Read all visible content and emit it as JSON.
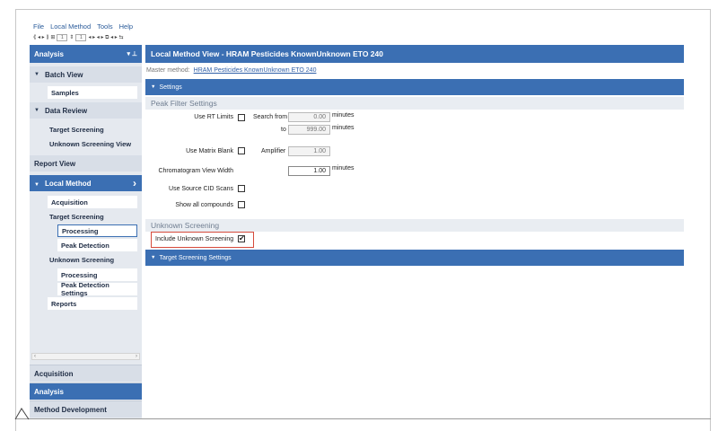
{
  "menu": {
    "file": "File",
    "local_method": "Local Method",
    "tools": "Tools",
    "help": "Help"
  },
  "toolbar": {
    "field_1": "1",
    "field_2": "1",
    "glyphs": "⟪ ◂ ▸ ⟫ ⊞",
    "glyphs2": "◂ ▸ ◂ ▸ ⧉ ◂ ▸ ⇆"
  },
  "nav": {
    "title": "Analysis",
    "pin_icon": "▾ ⊥",
    "batch_view": "Batch View",
    "samples": "Samples",
    "data_review": "Data Review",
    "target_screening": "Target Screening",
    "unknown_screening_view": "Unknown Screening View",
    "report_view": "Report View",
    "local_method": "Local Method",
    "local_method_arrow": "›",
    "acquisition": "Acquisition",
    "lm_target_screening": "Target Screening",
    "processing": "Processing",
    "peak_detection": "Peak Detection",
    "lm_unknown_screening": "Unknown Screening",
    "us_processing": "Processing",
    "peak_detection_settings": "Peak Detection Settings",
    "reports": "Reports",
    "scroll_left": "‹",
    "scroll_right": "›"
  },
  "bottom_tabs": {
    "acquisition": "Acquisition",
    "analysis": "Analysis",
    "method_development": "Method Development"
  },
  "main": {
    "title": "Local Method View - HRAM Pesticides KnownUnknown ETO 240",
    "master_label": "Master method:",
    "master_link": "HRAM Pesticides KnownUnknown ETO 240",
    "settings_bar": "Settings",
    "peak_filter_settings": "Peak Filter Settings",
    "use_rt_limits": "Use RT Limits",
    "search_from": "Search from",
    "search_from_value": "0.00",
    "to": "to",
    "to_value": "999.00",
    "minutes": "minutes",
    "use_matrix_blank": "Use Matrix Blank",
    "amplifier": "Amplifier",
    "amplifier_value": "1.00",
    "chromatogram_view_width": "Chromatogram View Width",
    "chromatogram_value": "1.00",
    "use_source_cid_scans": "Use Source CID Scans",
    "show_all_compounds": "Show all compounds",
    "unknown_screening": "Unknown Screening",
    "include_unknown_screening": "Include Unknown Screening",
    "target_screening_settings": "Target Screening Settings"
  },
  "state": {
    "include_unknown_screening_checked": true,
    "use_rt_limits_checked": false,
    "use_matrix_blank_checked": false
  },
  "colors": {
    "accent": "#3b6fb3",
    "highlight_border": "#d64b3c",
    "nav_bg": "#e5e9ef"
  }
}
